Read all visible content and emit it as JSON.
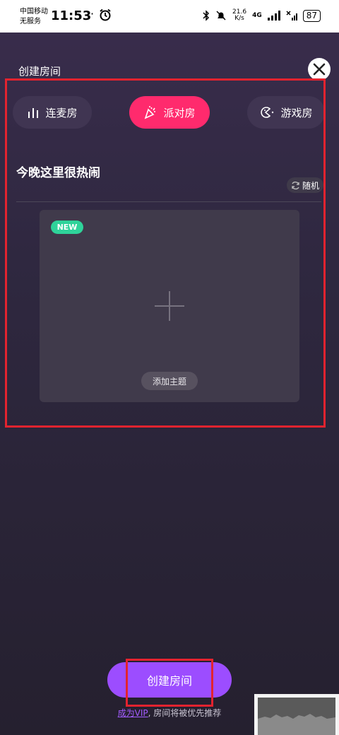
{
  "status_bar": {
    "carrier_line1": "中国移动",
    "carrier_line2": "无服务",
    "time": "11:53",
    "net_speed_value": "21.6",
    "net_speed_unit": "K/s",
    "network_type": "4G",
    "battery": "87"
  },
  "header": {
    "title": "创建房间"
  },
  "room_tabs": [
    {
      "label": "连麦房",
      "icon": "bar-chart-icon"
    },
    {
      "label": "派对房",
      "icon": "party-popper-icon",
      "selected": true
    },
    {
      "label": "游戏房",
      "icon": "pacman-icon"
    }
  ],
  "room_name": "今晚这里很热闹",
  "random_label": "随机",
  "theme_card": {
    "badge": "NEW",
    "add_label": "添加主题"
  },
  "create_button_label": "创建房间",
  "vip_hint": {
    "link": "成为VIP",
    "text": ", 房间将被优先推荐"
  },
  "colors": {
    "selected_tab": "#ff2a6d",
    "primary_button": "#9c4dff",
    "new_badge": "#2fd39a",
    "annotation": "#e3232f"
  }
}
